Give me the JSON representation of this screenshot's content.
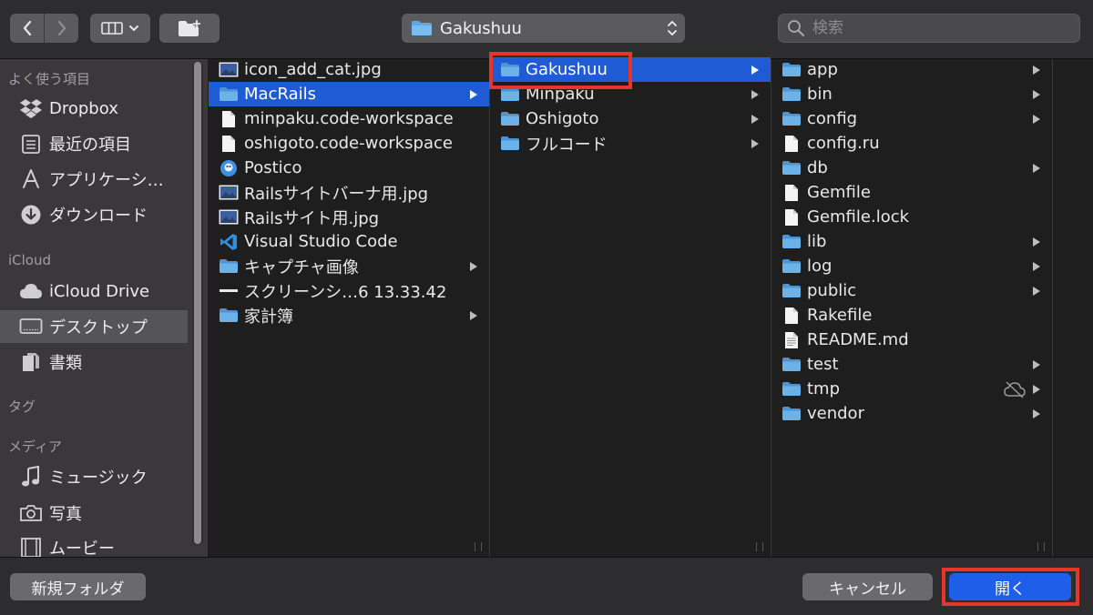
{
  "toolbar": {
    "location": "Gakushuu",
    "search_placeholder": "検索"
  },
  "sidebar": {
    "favorites_heading": "よく使う項目",
    "favorites": [
      {
        "label": "Dropbox",
        "icon": "dropbox-icon"
      },
      {
        "label": "最近の項目",
        "icon": "recents-icon"
      },
      {
        "label": "アプリケーシ…",
        "icon": "applications-icon"
      },
      {
        "label": "ダウンロード",
        "icon": "downloads-icon"
      }
    ],
    "icloud_heading": "iCloud",
    "icloud": [
      {
        "label": "iCloud Drive",
        "icon": "cloud-icon"
      },
      {
        "label": "デスクトップ",
        "icon": "desktop-icon",
        "selected": true
      },
      {
        "label": "書類",
        "icon": "documents-icon"
      }
    ],
    "tags_heading": "タグ",
    "media_heading": "メディア",
    "media": [
      {
        "label": "ミュージック",
        "icon": "music-icon"
      },
      {
        "label": "写真",
        "icon": "camera-icon"
      },
      {
        "label": "ムービー",
        "icon": "film-icon"
      }
    ]
  },
  "columns": {
    "desktop": [
      {
        "label": "icon_add_cat.jpg",
        "kind": "image"
      },
      {
        "label": "MacRails",
        "kind": "folder",
        "selected": true
      },
      {
        "label": "minpaku.code-workspace",
        "kind": "file"
      },
      {
        "label": "oshigoto.code-workspace",
        "kind": "file"
      },
      {
        "label": "Postico",
        "kind": "app"
      },
      {
        "label": "Railsサイトバーナ用.jpg",
        "kind": "image"
      },
      {
        "label": "Railsサイト用.jpg",
        "kind": "image"
      },
      {
        "label": "Visual Studio Code",
        "kind": "vscode"
      },
      {
        "label": "キャプチャ画像",
        "kind": "folder"
      },
      {
        "label": "スクリーンシ…6 13.33.42",
        "kind": "screenshot"
      },
      {
        "label": "家計簿",
        "kind": "folder"
      }
    ],
    "macrails": [
      {
        "label": "Gakushuu",
        "kind": "folder",
        "selected": true
      },
      {
        "label": "Minpaku",
        "kind": "folder"
      },
      {
        "label": "Oshigoto",
        "kind": "folder"
      },
      {
        "label": "フルコード",
        "kind": "folder"
      }
    ],
    "gakushuu": [
      {
        "label": "app",
        "kind": "folder"
      },
      {
        "label": "bin",
        "kind": "folder"
      },
      {
        "label": "config",
        "kind": "folder"
      },
      {
        "label": "config.ru",
        "kind": "file"
      },
      {
        "label": "db",
        "kind": "folder"
      },
      {
        "label": "Gemfile",
        "kind": "file"
      },
      {
        "label": "Gemfile.lock",
        "kind": "file"
      },
      {
        "label": "lib",
        "kind": "folder"
      },
      {
        "label": "log",
        "kind": "folder"
      },
      {
        "label": "public",
        "kind": "folder"
      },
      {
        "label": "Rakefile",
        "kind": "file"
      },
      {
        "label": "README.md",
        "kind": "textfile"
      },
      {
        "label": "test",
        "kind": "folder"
      },
      {
        "label": "tmp",
        "kind": "folder",
        "cloud_off": true
      },
      {
        "label": "vendor",
        "kind": "folder"
      }
    ]
  },
  "buttons": {
    "new_folder": "新規フォルダ",
    "cancel": "キャンセル",
    "open": "開く"
  },
  "colors": {
    "selection": "#1f5bd5",
    "folder": "#6bb2e8",
    "highlight_box": "#e5362c",
    "open_button": "#1e5ee8"
  }
}
